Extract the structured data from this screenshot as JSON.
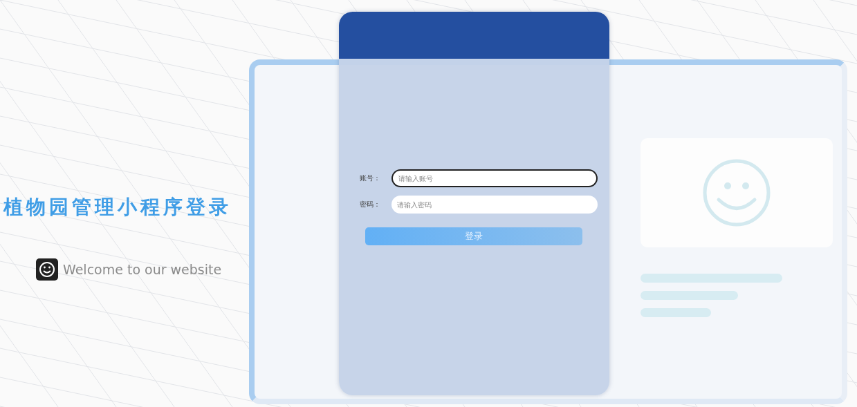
{
  "title": "植物园管理小程序登录",
  "welcome": {
    "text": "Welcome to our website"
  },
  "form": {
    "fields": [
      {
        "label": "账号：",
        "placeholder": "请输入账号",
        "focused": true
      },
      {
        "label": "密码：",
        "placeholder": "请输入密码",
        "focused": false
      }
    ],
    "submit": "登录"
  }
}
